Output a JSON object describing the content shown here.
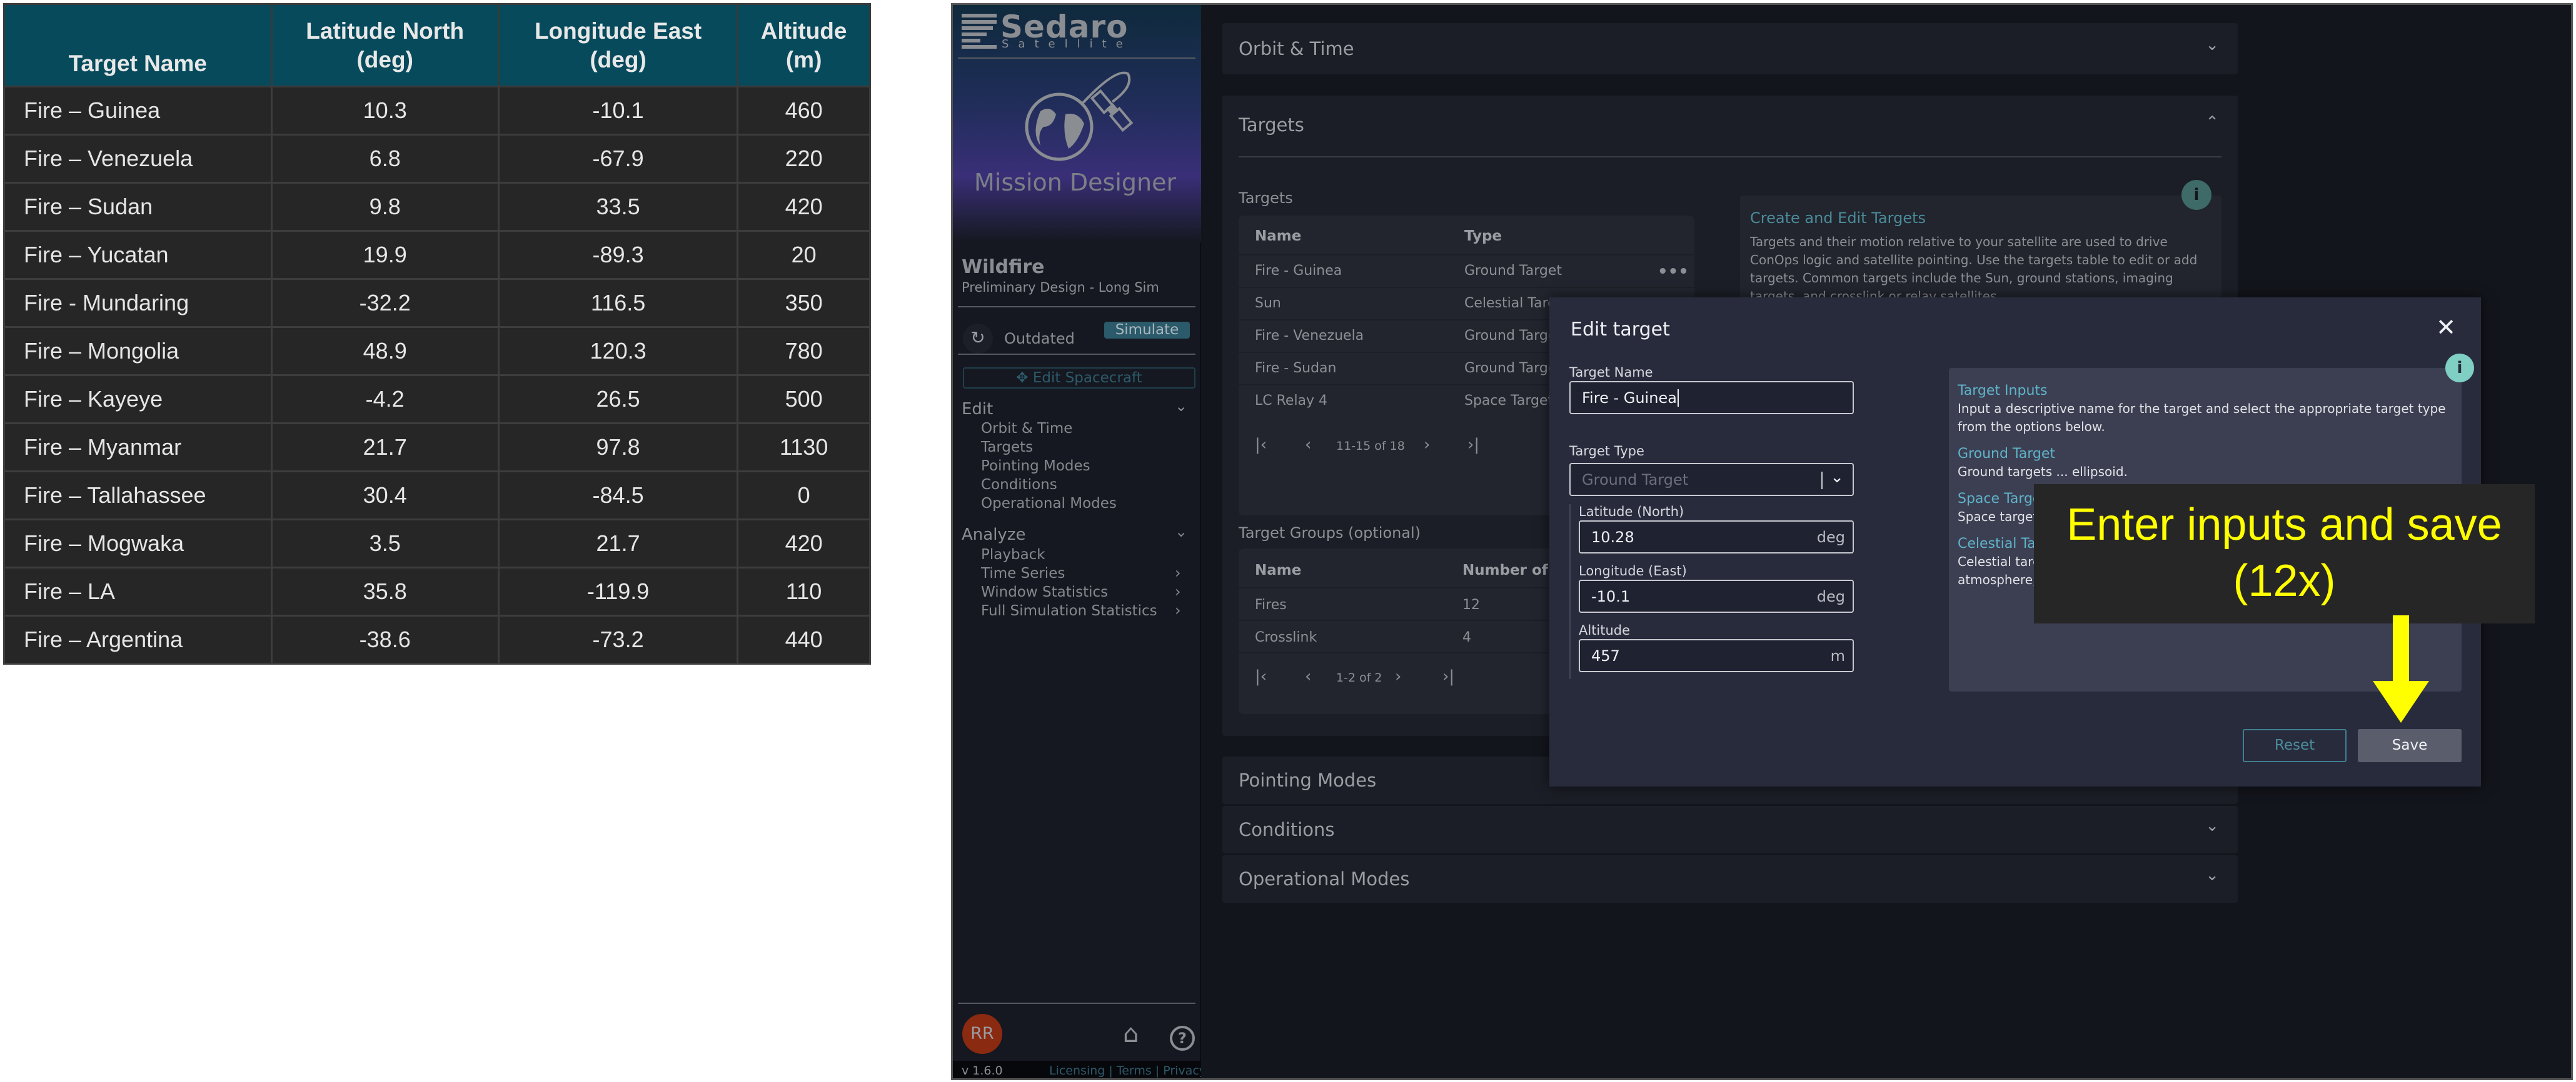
{
  "reference_table": {
    "headers": [
      "Target Name",
      "Latitude North\n(deg)",
      "Longitude East\n(deg)",
      "Altitude\n(m)"
    ],
    "rows": [
      [
        "Fire – Guinea",
        "10.3",
        "-10.1",
        "460"
      ],
      [
        "Fire – Venezuela",
        "6.8",
        "-67.9",
        "220"
      ],
      [
        "Fire – Sudan",
        "9.8",
        "33.5",
        "420"
      ],
      [
        "Fire – Yucatan",
        "19.9",
        "-89.3",
        "20"
      ],
      [
        "Fire - Mundaring",
        "-32.2",
        "116.5",
        "350"
      ],
      [
        "Fire – Mongolia",
        "48.9",
        "120.3",
        "780"
      ],
      [
        "Fire – Kayeye",
        "-4.2",
        "26.5",
        "500"
      ],
      [
        "Fire – Myanmar",
        "21.7",
        "97.8",
        "1130"
      ],
      [
        "Fire – Tallahassee",
        "30.4",
        "-84.5",
        "0"
      ],
      [
        "Fire – Mogwaka",
        "3.5",
        "21.7",
        "420"
      ],
      [
        "Fire – LA",
        "35.8",
        "-119.9",
        "110"
      ],
      [
        "Fire – Argentina",
        "-38.6",
        "-73.2",
        "440"
      ]
    ]
  },
  "sidebar": {
    "logo_text": "Sedaro",
    "logo_sub": "Satellite",
    "app_name": "Mission Designer",
    "project_name": "Wildfire",
    "project_sub": "Preliminary Design - Long Sim",
    "status": "Outdated",
    "simulate": "Simulate",
    "edit_spacecraft": "Edit Spacecraft",
    "edit_section": "Edit",
    "edit_items": [
      "Orbit & Time",
      "Targets",
      "Pointing Modes",
      "Conditions",
      "Operational Modes"
    ],
    "analyze_section": "Analyze",
    "analyze_items": [
      "Playback",
      "Time Series",
      "Window Statistics",
      "Full Simulation Statistics"
    ],
    "avatar": "RR",
    "version": "v 1.6.0",
    "links": [
      "Licensing",
      "Terms",
      "Privacy"
    ]
  },
  "main": {
    "orbit_time": "Orbit & Time",
    "targets_section": "Targets",
    "targets_label": "Targets",
    "targets_table": {
      "headers": [
        "Name",
        "Type"
      ],
      "rows": [
        [
          "Fire - Guinea",
          "Ground Target"
        ],
        [
          "Sun",
          "Celestial Target"
        ],
        [
          "Fire - Venezuela",
          "Ground Target"
        ],
        [
          "Fire - Sudan",
          "Ground Target"
        ],
        [
          "LC Relay 4",
          "Space Target"
        ]
      ],
      "pagination": "11-15 of 18"
    },
    "info": {
      "title": "Create and Edit Targets",
      "body": "Targets and their motion relative to your satellite are used to drive ConOps logic and satellite pointing. Use the targets table to edit or add targets. Common targets include the Sun, ground stations, imaging targets, and crosslink or relay satellites."
    },
    "groups_label": "Target Groups (optional)",
    "groups_table": {
      "headers": [
        "Name",
        "Number of Targets"
      ],
      "rows": [
        [
          "Fires",
          "12"
        ],
        [
          "Crosslink",
          "4"
        ]
      ],
      "pagination": "1-2 of 2"
    },
    "pointing_modes": "Pointing Modes",
    "conditions": "Conditions",
    "operational_modes": "Operational Modes"
  },
  "modal": {
    "title": "Edit target",
    "name_label": "Target Name",
    "name_value": "Fire - Guinea",
    "type_label": "Target Type",
    "type_value": "Ground Target",
    "lat_label": "Latitude (North)",
    "lat_value": "10.28",
    "lat_unit": "deg",
    "lon_label": "Longitude (East)",
    "lon_value": "-10.1",
    "lon_unit": "deg",
    "alt_label": "Altitude",
    "alt_value": "457",
    "alt_unit": "m",
    "info": {
      "title": "Target Inputs",
      "intro": "Input a descriptive name for the target and select the appropriate target type from the options below.",
      "ground_title": "Ground Target",
      "ground_body": "Ground targets ... ellipsoid.",
      "space_title": "Space Target",
      "space_body": "Space targets ... targeted by y",
      "celestial_title": "Celestial Target",
      "celestial_body": "Celestial targets are natural objects which are located outside of Earth's atmosphere, such as the Moon and Sun."
    },
    "reset": "Reset",
    "save": "Save"
  },
  "annotation": {
    "line1": "Enter inputs and save",
    "line2": "(12x)",
    "color": "#ffff00"
  },
  "colors": {
    "table_header": "#064a5c",
    "accent_teal": "#5fb3c9",
    "simulate_bg": "#2b5a6a",
    "avatar": "#8a2a10"
  }
}
